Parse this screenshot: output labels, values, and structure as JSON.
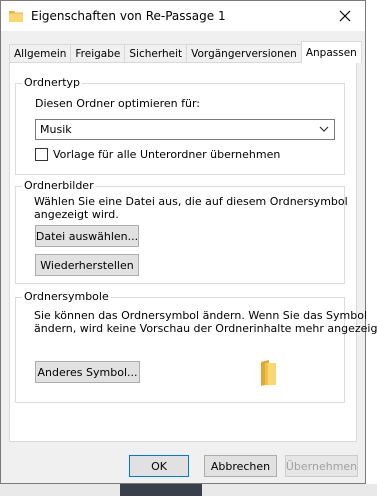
{
  "window": {
    "title": "Eigenschaften von Re-Passage 1"
  },
  "tabs": [
    {
      "label": "Allgemein",
      "active": false
    },
    {
      "label": "Freigabe",
      "active": false
    },
    {
      "label": "Sicherheit",
      "active": false
    },
    {
      "label": "Vorgängerversionen",
      "active": false
    },
    {
      "label": "Anpassen",
      "active": true
    }
  ],
  "ordnertyp": {
    "title": "Ordnertyp",
    "optimize_label": "Diesen Ordner optimieren für:",
    "selected": "Musik",
    "checkbox_label": "Vorlage für alle Unterordner übernehmen",
    "checked": false
  },
  "ordnerbilder": {
    "title": "Ordnerbilder",
    "description_line1": "Wählen Sie eine Datei aus, die auf diesem Ordnersymbol",
    "description_line2": "angezeigt wird.",
    "choose_button": "Datei auswählen...",
    "restore_button": "Wiederherstellen"
  },
  "ordnersymbole": {
    "title": "Ordnersymbole",
    "description_line1": "Sie können das Ordnersymbol ändern. Wenn Sie das Symbol",
    "description_line2": "ändern, wird keine Vorschau der Ordnerinhalte mehr angezeigt.",
    "change_button": "Anderes Symbol..."
  },
  "footer": {
    "ok": "OK",
    "cancel": "Abbrechen",
    "apply": "Übernehmen"
  },
  "colors": {
    "folder": "#f4c542",
    "accent": "#0078d7"
  }
}
